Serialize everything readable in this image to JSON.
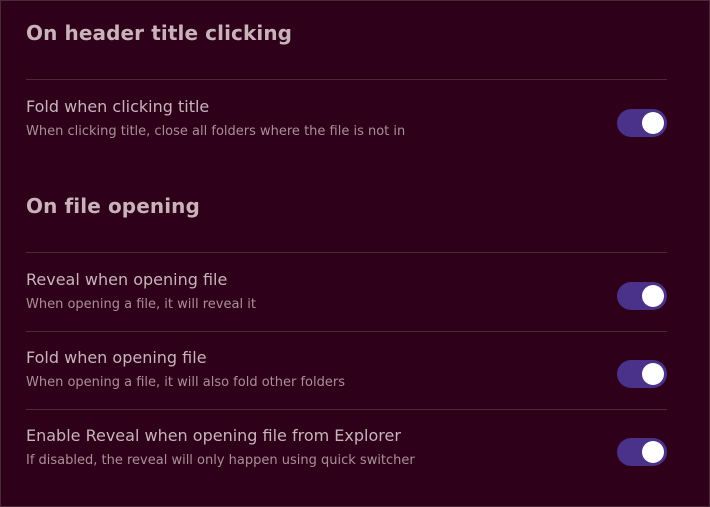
{
  "sections": [
    {
      "heading": "On header title clicking",
      "settings": [
        {
          "name": "Fold when clicking title",
          "description": "When clicking title, close all folders where the file is not in",
          "enabled": true
        }
      ]
    },
    {
      "heading": "On file opening",
      "settings": [
        {
          "name": "Reveal when opening file",
          "description": "When opening a file, it will reveal it",
          "enabled": true
        },
        {
          "name": "Fold when opening file",
          "description": "When opening a file, it will also fold other folders",
          "enabled": true
        },
        {
          "name": "Enable Reveal when opening file from Explorer",
          "description": "If disabled, the reveal will only happen using quick switcher",
          "enabled": true
        }
      ]
    }
  ],
  "colors": {
    "background": "#2f0019",
    "toggle_on": "#4a3189",
    "toggle_knob": "#ffffff"
  }
}
